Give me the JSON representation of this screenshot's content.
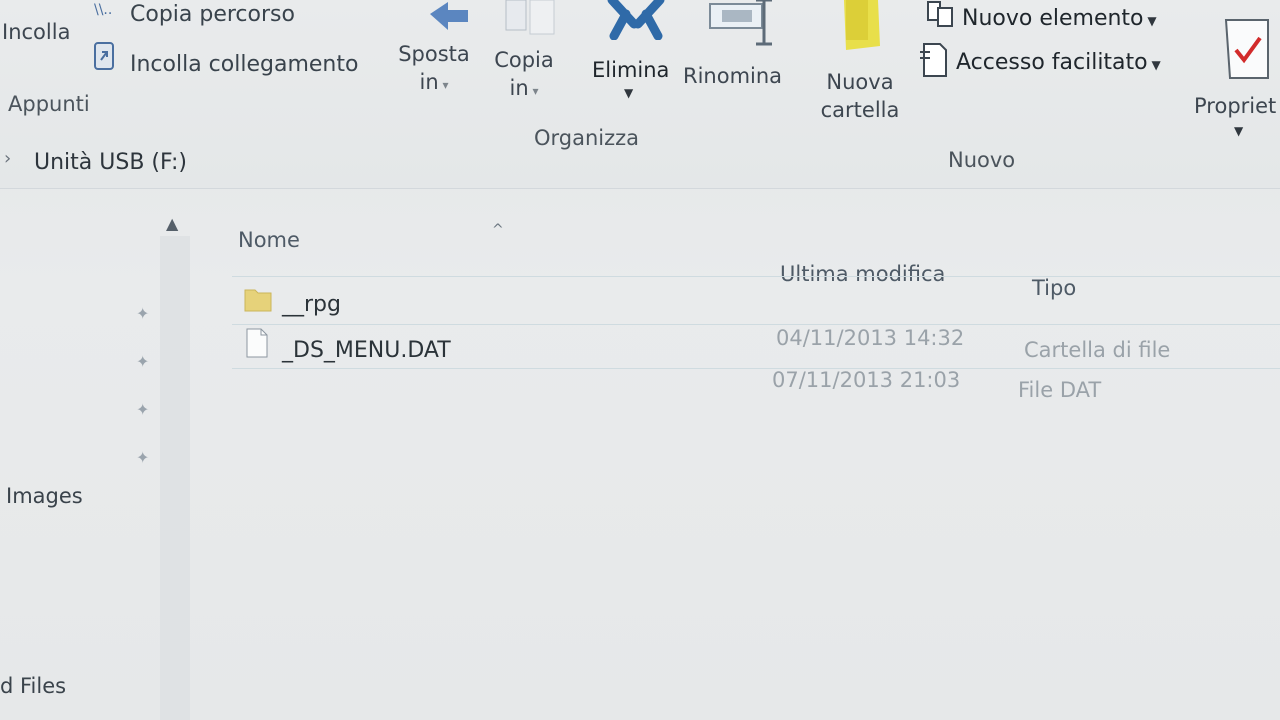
{
  "ribbon": {
    "paste_label": "Incolla",
    "copy_path_label": "Copia percorso",
    "paste_link_label": "Incolla collegamento",
    "clipboard_group": "Appunti",
    "move_to_label_1": "Sposta",
    "move_to_label_2": "in",
    "copy_to_label_1": "Copia",
    "copy_to_label_2": "in",
    "delete_label": "Elimina",
    "rename_label": "Rinomina",
    "organize_group": "Organizza",
    "new_folder_label_1": "Nuova",
    "new_folder_label_2": "cartella",
    "new_item_label": "Nuovo elemento",
    "easy_access_label": "Accesso facilitato",
    "new_group": "Nuovo",
    "properties_label": "Propriet"
  },
  "breadcrumb": {
    "location": "Unità USB (F:)"
  },
  "sidebar": {
    "items": [
      "Images",
      "d Files"
    ]
  },
  "columns": {
    "name": "Nome",
    "modified": "Ultima modifica",
    "type": "Tipo"
  },
  "files": [
    {
      "name": "__rpg",
      "modified": "04/11/2013 14:32",
      "type": "Cartella di file"
    },
    {
      "name": "_DS_MENU.DAT",
      "modified": "07/11/2013 21:03",
      "type": "File DAT"
    }
  ],
  "colors": {
    "folder": "#e6d27a",
    "delete_x": "#2f6aa8",
    "new_folder_yellow": "#e8df4a",
    "properties_check": "#d22b2b"
  }
}
